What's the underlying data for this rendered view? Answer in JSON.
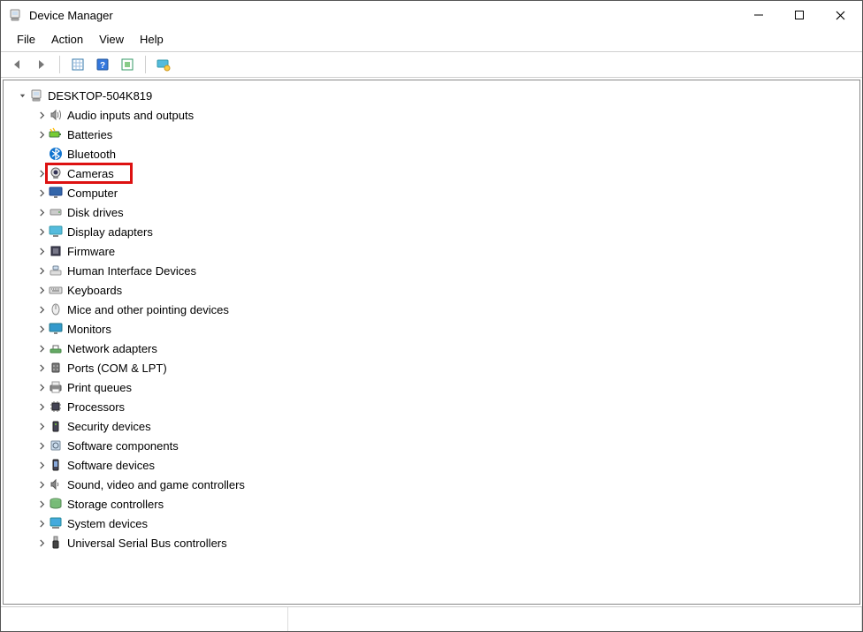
{
  "window": {
    "title": "Device Manager"
  },
  "menu": {
    "file": "File",
    "action": "Action",
    "view": "View",
    "help": "Help"
  },
  "toolbarButtons": [
    "back",
    "forward",
    "sep",
    "show-hidden",
    "help",
    "update-driver",
    "monitor"
  ],
  "tree": {
    "root": {
      "label": "DESKTOP-504K819",
      "expanded": true
    },
    "items": [
      {
        "id": "audio",
        "label": "Audio inputs and outputs",
        "icon": "speaker",
        "chev": true
      },
      {
        "id": "batteries",
        "label": "Batteries",
        "icon": "battery",
        "chev": true
      },
      {
        "id": "bluetooth",
        "label": "Bluetooth",
        "icon": "bluetooth",
        "chev": false
      },
      {
        "id": "cameras",
        "label": "Cameras",
        "icon": "camera",
        "chev": true,
        "highlight": true
      },
      {
        "id": "computer",
        "label": "Computer",
        "icon": "monitor",
        "chev": true
      },
      {
        "id": "disk",
        "label": "Disk drives",
        "icon": "disk",
        "chev": true
      },
      {
        "id": "display",
        "label": "Display adapters",
        "icon": "display",
        "chev": true
      },
      {
        "id": "firmware",
        "label": "Firmware",
        "icon": "chip",
        "chev": true
      },
      {
        "id": "hid",
        "label": "Human Interface Devices",
        "icon": "hid",
        "chev": true
      },
      {
        "id": "keyboards",
        "label": "Keyboards",
        "icon": "keyboard",
        "chev": true
      },
      {
        "id": "mice",
        "label": "Mice and other pointing devices",
        "icon": "mouse",
        "chev": true
      },
      {
        "id": "monitors",
        "label": "Monitors",
        "icon": "monitor2",
        "chev": true
      },
      {
        "id": "network",
        "label": "Network adapters",
        "icon": "network",
        "chev": true
      },
      {
        "id": "ports",
        "label": "Ports (COM & LPT)",
        "icon": "port",
        "chev": true
      },
      {
        "id": "printq",
        "label": "Print queues",
        "icon": "printer",
        "chev": true
      },
      {
        "id": "cpu",
        "label": "Processors",
        "icon": "cpu",
        "chev": true
      },
      {
        "id": "security",
        "label": "Security devices",
        "icon": "security",
        "chev": true
      },
      {
        "id": "swcomp",
        "label": "Software components",
        "icon": "swcomp",
        "chev": true
      },
      {
        "id": "swdev",
        "label": "Software devices",
        "icon": "swdev",
        "chev": true
      },
      {
        "id": "sound",
        "label": "Sound, video and game controllers",
        "icon": "sound",
        "chev": true
      },
      {
        "id": "storage",
        "label": "Storage controllers",
        "icon": "storage",
        "chev": true
      },
      {
        "id": "system",
        "label": "System devices",
        "icon": "system",
        "chev": true
      },
      {
        "id": "usb",
        "label": "Universal Serial Bus controllers",
        "icon": "usb",
        "chev": true
      }
    ]
  }
}
